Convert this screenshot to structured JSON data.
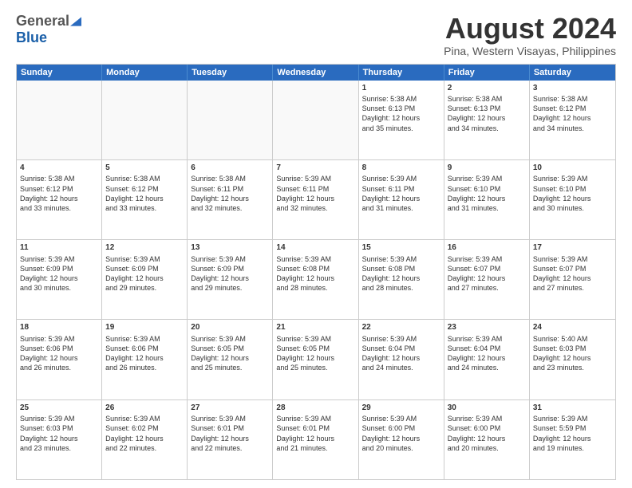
{
  "logo": {
    "general": "General",
    "blue": "Blue"
  },
  "title": "August 2024",
  "subtitle": "Pina, Western Visayas, Philippines",
  "days": [
    "Sunday",
    "Monday",
    "Tuesday",
    "Wednesday",
    "Thursday",
    "Friday",
    "Saturday"
  ],
  "rows": [
    [
      {
        "num": "",
        "lines": []
      },
      {
        "num": "",
        "lines": []
      },
      {
        "num": "",
        "lines": []
      },
      {
        "num": "",
        "lines": []
      },
      {
        "num": "1",
        "lines": [
          "Sunrise: 5:38 AM",
          "Sunset: 6:13 PM",
          "Daylight: 12 hours",
          "and 35 minutes."
        ]
      },
      {
        "num": "2",
        "lines": [
          "Sunrise: 5:38 AM",
          "Sunset: 6:13 PM",
          "Daylight: 12 hours",
          "and 34 minutes."
        ]
      },
      {
        "num": "3",
        "lines": [
          "Sunrise: 5:38 AM",
          "Sunset: 6:12 PM",
          "Daylight: 12 hours",
          "and 34 minutes."
        ]
      }
    ],
    [
      {
        "num": "4",
        "lines": [
          "Sunrise: 5:38 AM",
          "Sunset: 6:12 PM",
          "Daylight: 12 hours",
          "and 33 minutes."
        ]
      },
      {
        "num": "5",
        "lines": [
          "Sunrise: 5:38 AM",
          "Sunset: 6:12 PM",
          "Daylight: 12 hours",
          "and 33 minutes."
        ]
      },
      {
        "num": "6",
        "lines": [
          "Sunrise: 5:38 AM",
          "Sunset: 6:11 PM",
          "Daylight: 12 hours",
          "and 32 minutes."
        ]
      },
      {
        "num": "7",
        "lines": [
          "Sunrise: 5:39 AM",
          "Sunset: 6:11 PM",
          "Daylight: 12 hours",
          "and 32 minutes."
        ]
      },
      {
        "num": "8",
        "lines": [
          "Sunrise: 5:39 AM",
          "Sunset: 6:11 PM",
          "Daylight: 12 hours",
          "and 31 minutes."
        ]
      },
      {
        "num": "9",
        "lines": [
          "Sunrise: 5:39 AM",
          "Sunset: 6:10 PM",
          "Daylight: 12 hours",
          "and 31 minutes."
        ]
      },
      {
        "num": "10",
        "lines": [
          "Sunrise: 5:39 AM",
          "Sunset: 6:10 PM",
          "Daylight: 12 hours",
          "and 30 minutes."
        ]
      }
    ],
    [
      {
        "num": "11",
        "lines": [
          "Sunrise: 5:39 AM",
          "Sunset: 6:09 PM",
          "Daylight: 12 hours",
          "and 30 minutes."
        ]
      },
      {
        "num": "12",
        "lines": [
          "Sunrise: 5:39 AM",
          "Sunset: 6:09 PM",
          "Daylight: 12 hours",
          "and 29 minutes."
        ]
      },
      {
        "num": "13",
        "lines": [
          "Sunrise: 5:39 AM",
          "Sunset: 6:09 PM",
          "Daylight: 12 hours",
          "and 29 minutes."
        ]
      },
      {
        "num": "14",
        "lines": [
          "Sunrise: 5:39 AM",
          "Sunset: 6:08 PM",
          "Daylight: 12 hours",
          "and 28 minutes."
        ]
      },
      {
        "num": "15",
        "lines": [
          "Sunrise: 5:39 AM",
          "Sunset: 6:08 PM",
          "Daylight: 12 hours",
          "and 28 minutes."
        ]
      },
      {
        "num": "16",
        "lines": [
          "Sunrise: 5:39 AM",
          "Sunset: 6:07 PM",
          "Daylight: 12 hours",
          "and 27 minutes."
        ]
      },
      {
        "num": "17",
        "lines": [
          "Sunrise: 5:39 AM",
          "Sunset: 6:07 PM",
          "Daylight: 12 hours",
          "and 27 minutes."
        ]
      }
    ],
    [
      {
        "num": "18",
        "lines": [
          "Sunrise: 5:39 AM",
          "Sunset: 6:06 PM",
          "Daylight: 12 hours",
          "and 26 minutes."
        ]
      },
      {
        "num": "19",
        "lines": [
          "Sunrise: 5:39 AM",
          "Sunset: 6:06 PM",
          "Daylight: 12 hours",
          "and 26 minutes."
        ]
      },
      {
        "num": "20",
        "lines": [
          "Sunrise: 5:39 AM",
          "Sunset: 6:05 PM",
          "Daylight: 12 hours",
          "and 25 minutes."
        ]
      },
      {
        "num": "21",
        "lines": [
          "Sunrise: 5:39 AM",
          "Sunset: 6:05 PM",
          "Daylight: 12 hours",
          "and 25 minutes."
        ]
      },
      {
        "num": "22",
        "lines": [
          "Sunrise: 5:39 AM",
          "Sunset: 6:04 PM",
          "Daylight: 12 hours",
          "and 24 minutes."
        ]
      },
      {
        "num": "23",
        "lines": [
          "Sunrise: 5:39 AM",
          "Sunset: 6:04 PM",
          "Daylight: 12 hours",
          "and 24 minutes."
        ]
      },
      {
        "num": "24",
        "lines": [
          "Sunrise: 5:40 AM",
          "Sunset: 6:03 PM",
          "Daylight: 12 hours",
          "and 23 minutes."
        ]
      }
    ],
    [
      {
        "num": "25",
        "lines": [
          "Sunrise: 5:39 AM",
          "Sunset: 6:03 PM",
          "Daylight: 12 hours",
          "and 23 minutes."
        ]
      },
      {
        "num": "26",
        "lines": [
          "Sunrise: 5:39 AM",
          "Sunset: 6:02 PM",
          "Daylight: 12 hours",
          "and 22 minutes."
        ]
      },
      {
        "num": "27",
        "lines": [
          "Sunrise: 5:39 AM",
          "Sunset: 6:01 PM",
          "Daylight: 12 hours",
          "and 22 minutes."
        ]
      },
      {
        "num": "28",
        "lines": [
          "Sunrise: 5:39 AM",
          "Sunset: 6:01 PM",
          "Daylight: 12 hours",
          "and 21 minutes."
        ]
      },
      {
        "num": "29",
        "lines": [
          "Sunrise: 5:39 AM",
          "Sunset: 6:00 PM",
          "Daylight: 12 hours",
          "and 20 minutes."
        ]
      },
      {
        "num": "30",
        "lines": [
          "Sunrise: 5:39 AM",
          "Sunset: 6:00 PM",
          "Daylight: 12 hours",
          "and 20 minutes."
        ]
      },
      {
        "num": "31",
        "lines": [
          "Sunrise: 5:39 AM",
          "Sunset: 5:59 PM",
          "Daylight: 12 hours",
          "and 19 minutes."
        ]
      }
    ]
  ]
}
